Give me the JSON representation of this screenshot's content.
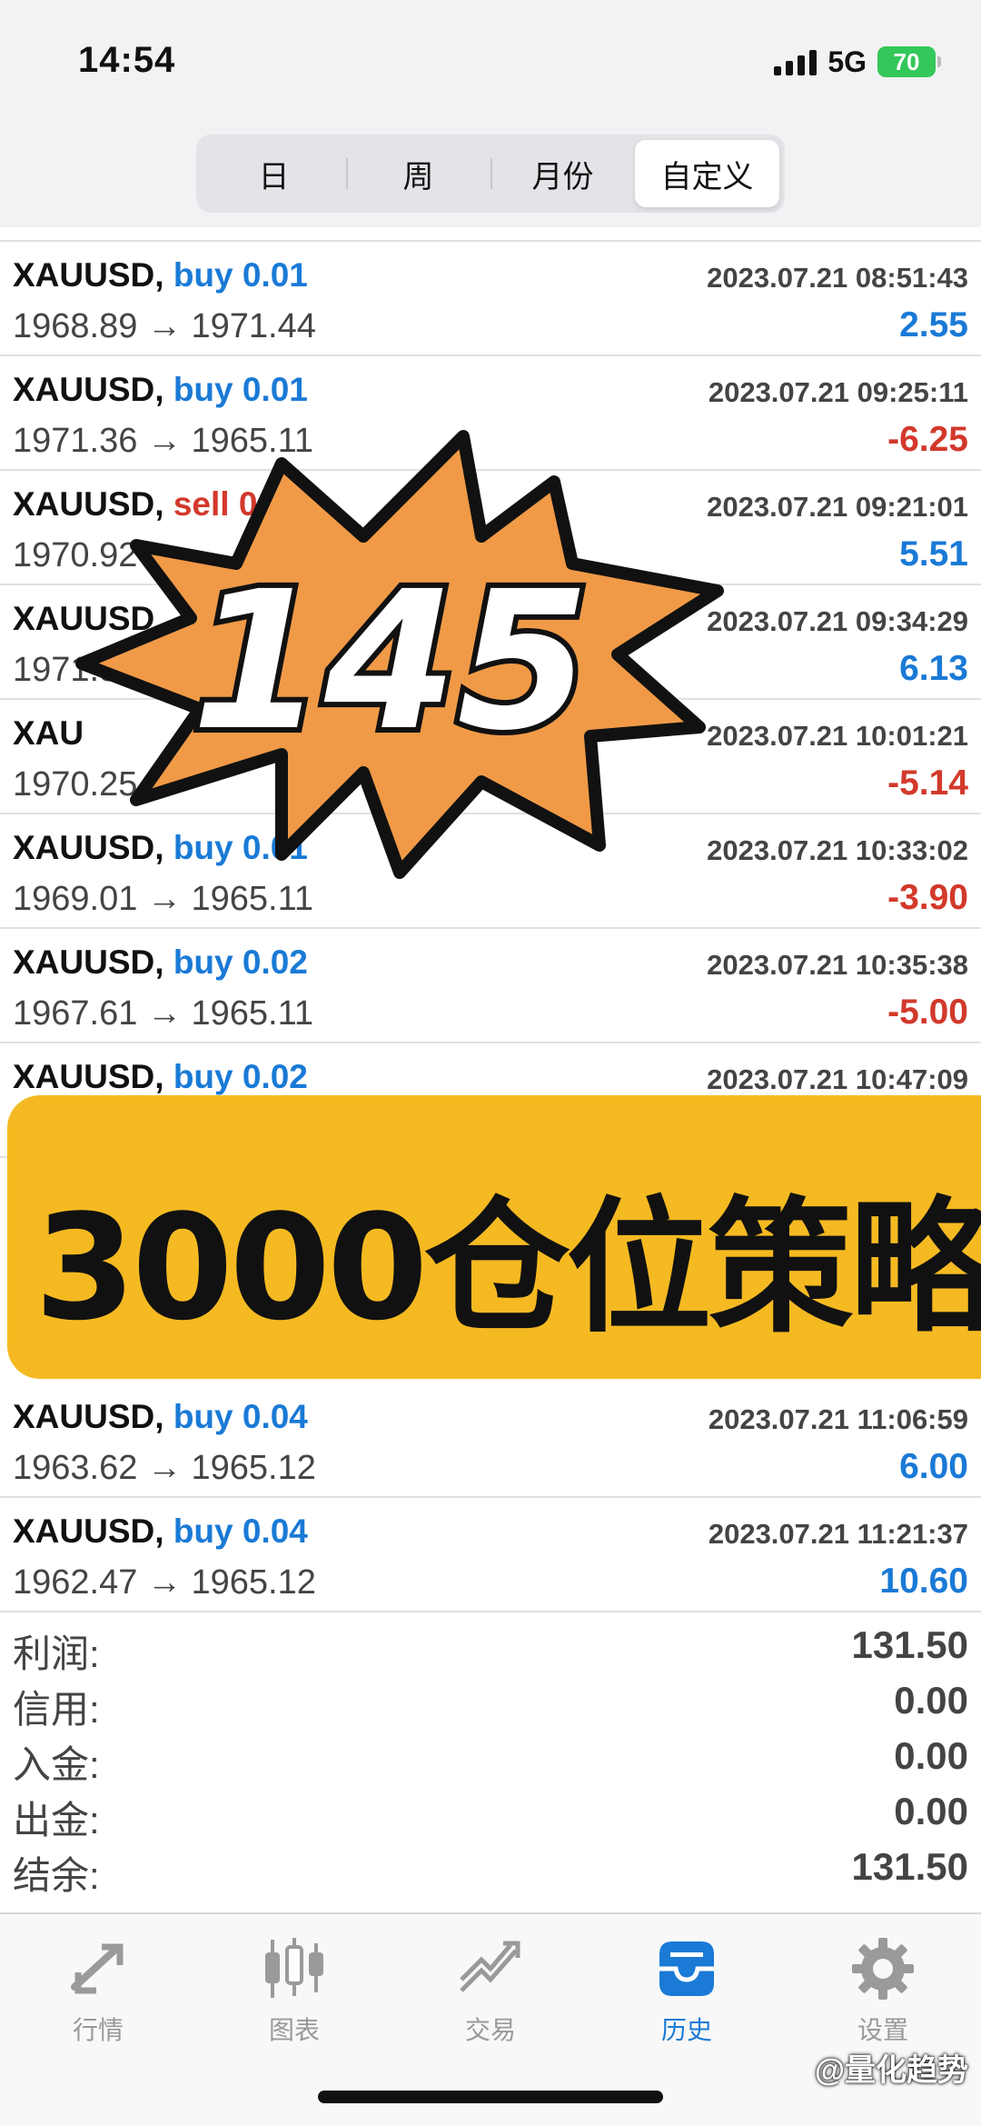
{
  "status_bar": {
    "time": "14:54",
    "network": "5G",
    "battery": "70"
  },
  "tabs": [
    {
      "label": "日"
    },
    {
      "label": "周"
    },
    {
      "label": "月份"
    },
    {
      "label": "自定义",
      "active": true
    }
  ],
  "trades_top": [
    {
      "symbol": "XAUUSD,",
      "side": "buy",
      "lots": "0.01",
      "datetime": "2023.07.21 08:51:43",
      "open": "1968.89",
      "close": "1971.44",
      "profit": "2.55"
    },
    {
      "symbol": "XAUUSD,",
      "side": "buy",
      "lots": "0.01",
      "datetime": "2023.07.21 09:25:11",
      "open": "1971.36",
      "close": "1965.11",
      "profit": "-6.25"
    },
    {
      "symbol": "XAUUSD,",
      "side": "sell",
      "lots": "0.01",
      "datetime": "2023.07.21 09:21:01",
      "open": "1970.92",
      "close": "",
      "profit": "5.51"
    },
    {
      "symbol": "XAUUSD,",
      "side": "",
      "lots": "",
      "datetime": "2023.07.21 09:34:29",
      "open": "1971.5",
      "close": "",
      "profit": "6.13"
    },
    {
      "symbol": "XAU",
      "side": "",
      "lots": "",
      "datetime": "2023.07.21 10:01:21",
      "open": "1970.25",
      "close": "",
      "profit": "-5.14"
    },
    {
      "symbol": "XAUUSD,",
      "side": "buy",
      "lots": "0.01",
      "datetime": "2023.07.21 10:33:02",
      "open": "1969.01",
      "close": "1965.11",
      "profit": "-3.90"
    },
    {
      "symbol": "XAUUSD,",
      "side": "buy",
      "lots": "0.02",
      "datetime": "2023.07.21 10:35:38",
      "open": "1967.61",
      "close": "1965.11",
      "profit": "-5.00"
    },
    {
      "symbol": "XAUUSD,",
      "side": "buy",
      "lots": "0.02",
      "datetime": "2023.07.21 10:47:09",
      "open": "",
      "close": "",
      "profit": ""
    }
  ],
  "trades_bottom": [
    {
      "symbol": "XAUUSD,",
      "side": "buy",
      "lots": "0.04",
      "datetime": "2023.07.21 11:06:59",
      "open": "1963.62",
      "close": "1965.12",
      "profit": "6.00"
    },
    {
      "symbol": "XAUUSD,",
      "side": "buy",
      "lots": "0.04",
      "datetime": "2023.07.21 11:21:37",
      "open": "1962.47",
      "close": "1965.12",
      "profit": "10.60"
    }
  ],
  "arrow": "→",
  "overlay": {
    "burst_number": "145",
    "banner_text": "3000仓位策略"
  },
  "summary": [
    {
      "label": "利润:",
      "value": "131.50"
    },
    {
      "label": "信用:",
      "value": "0.00"
    },
    {
      "label": "入金:",
      "value": "0.00"
    },
    {
      "label": "出金:",
      "value": "0.00"
    },
    {
      "label": "结余:",
      "value": "131.50"
    }
  ],
  "tabbar": [
    {
      "label": "行情",
      "icon": "quotes-icon"
    },
    {
      "label": "图表",
      "icon": "chart-icon"
    },
    {
      "label": "交易",
      "icon": "trade-icon"
    },
    {
      "label": "历史",
      "icon": "history-icon",
      "active": true
    },
    {
      "label": "设置",
      "icon": "settings-icon"
    }
  ],
  "watermark": "@量化趋势",
  "colors": {
    "buy": "#1a7ad6",
    "sell": "#d2392b",
    "banner": "#f5ba22",
    "burst": "#f09a47"
  }
}
